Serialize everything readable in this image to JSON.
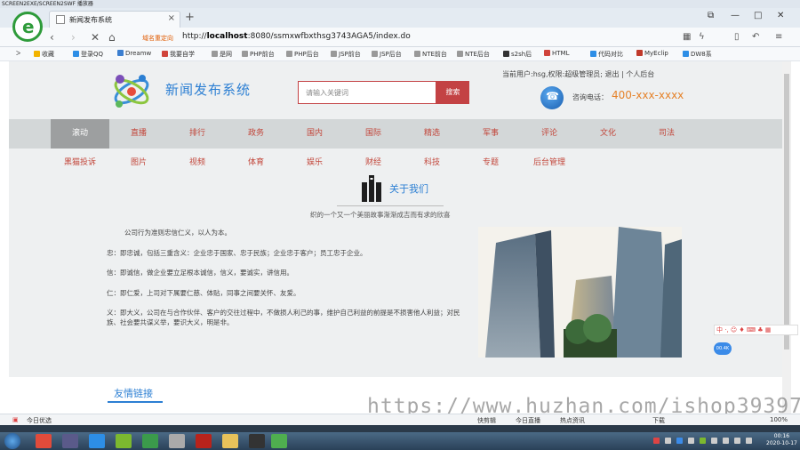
{
  "recorder": {
    "title": "SCREEN2EXE/SCREEN2SWF 播放器"
  },
  "browser": {
    "tab_title": "新闻发布系统",
    "tab_close": "×",
    "new_tab": "+",
    "redirect_tag": "域名重定向",
    "url_prefix": "http://",
    "url_host": "localhost",
    "url_rest": ":8080/ssmxwfbxthsg3743AGA5/index.do",
    "bookmarks": [
      {
        "label": "收藏",
        "color": "#f2b300"
      },
      {
        "label": "登录QQ",
        "color": "#2d8ee6"
      },
      {
        "label": "Dreamw",
        "color": "#3c7fd0"
      },
      {
        "label": "我要自学",
        "color": "#d0443b"
      },
      {
        "label": "是网",
        "color": "#999999"
      },
      {
        "label": "PHP前台",
        "color": "#999999"
      },
      {
        "label": "PHP后台",
        "color": "#999999"
      },
      {
        "label": "JSP前台",
        "color": "#999999"
      },
      {
        "label": "JSP后台",
        "color": "#999999"
      },
      {
        "label": "NTE前台",
        "color": "#999999"
      },
      {
        "label": "NTE后台",
        "color": "#999999"
      },
      {
        "label": "s2sh后",
        "color": "#333333"
      },
      {
        "label": "HTML",
        "color": "#d0443b"
      },
      {
        "label": "代码对比",
        "color": "#2d8ee6"
      },
      {
        "label": "MyEclip",
        "color": "#c0392b"
      },
      {
        "label": "DW8系",
        "color": "#2d8ee6"
      }
    ]
  },
  "header": {
    "user_info": "当前用户:hsg,权限:超级管理员; 退出 | 个人后台",
    "site_name": "新闻发布系统",
    "search_placeholder": "请输入关键词",
    "search_button": "搜索",
    "phone_label": "咨询电话：",
    "phone_number": "400-xxx-xxxx"
  },
  "nav": {
    "row1": [
      "滚动",
      "直播",
      "排行",
      "政务",
      "国内",
      "国际",
      "精选",
      "军事",
      "评论",
      "文化",
      "司法"
    ],
    "row2": [
      "黑猫投诉",
      "图片",
      "视频",
      "体育",
      "娱乐",
      "财经",
      "科技",
      "专题",
      "后台管理"
    ],
    "active_index": 0
  },
  "about": {
    "title": "关于我们",
    "subtitle": "织的一个又一个美丽故事渐渐成吉而有求的欣喜",
    "paragraphs": [
      "公司行为准则忠信仁义，以人为本。",
      "忠：即忠诚，包括三重含义：企业忠于国家、忠于民族；企业忠于客户；员工忠于企业。",
      "信：即诚信，做企业要立足根本诚信，信义，要诚实，讲信用。",
      "仁：即仁爱，上司对下属要仁慈、体贴，同事之间要关怀、友爱。",
      "义：即大义，公司在与合作伙伴、客户的交往过程中，不做损人利己的事，维护自己利益的前提是不损害他人利益；对民族、社会要共谋义举，要识大义，明是非。"
    ]
  },
  "friends": {
    "title": "友情链接"
  },
  "overlays": {
    "ime_text": "中 ·, ☺ ♦ ⌨ ♣ ▦",
    "speed_bubble": "00.4K",
    "watermark": "https://www.huzhan.com/ishop39397"
  },
  "status_bar": {
    "left": "今日优选",
    "items": [
      "快剪辑",
      "今日直播",
      "热点资讯"
    ],
    "download": "下载",
    "zoom": "100%"
  },
  "taskbar": {
    "time": "00:16",
    "date": "2020-10-17"
  }
}
